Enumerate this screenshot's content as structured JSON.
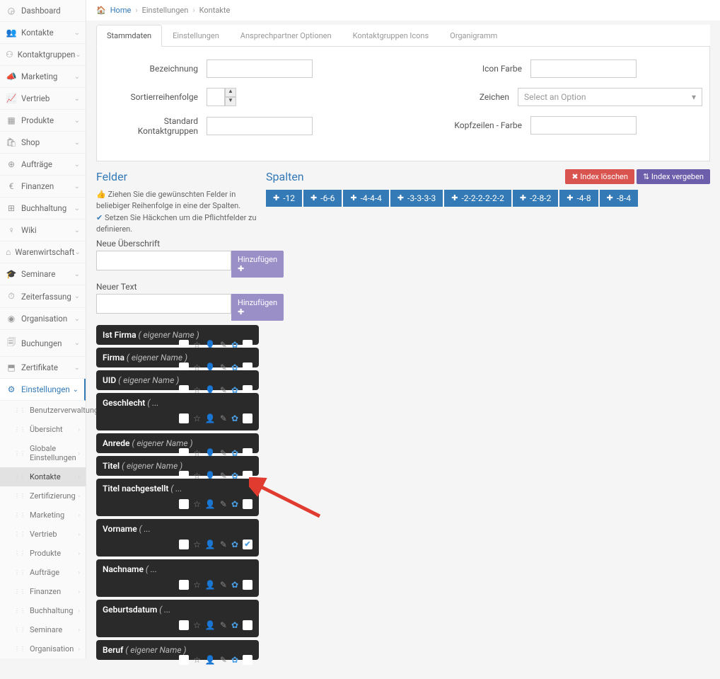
{
  "breadcrumb": {
    "home": "Home",
    "einstellungen": "Einstellungen",
    "kontakte": "Kontakte"
  },
  "nav": {
    "items": [
      {
        "label": "Dashboard",
        "icon": "◶",
        "expandable": false
      },
      {
        "label": "Kontakte",
        "icon": "👥",
        "expandable": true
      },
      {
        "label": "Kontaktgruppen",
        "icon": "⚇",
        "expandable": true
      },
      {
        "label": "Marketing",
        "icon": "📣",
        "expandable": true
      },
      {
        "label": "Vertrieb",
        "icon": "📈",
        "expandable": true
      },
      {
        "label": "Produkte",
        "icon": "▦",
        "expandable": true
      },
      {
        "label": "Shop",
        "icon": "🛍",
        "expandable": true
      },
      {
        "label": "Aufträge",
        "icon": "⊕",
        "expandable": true
      },
      {
        "label": "Finanzen",
        "icon": "€",
        "expandable": true
      },
      {
        "label": "Buchhaltung",
        "icon": "⊞",
        "expandable": true
      },
      {
        "label": "Wiki",
        "icon": "♀",
        "expandable": true
      },
      {
        "label": "Warenwirtschaft",
        "icon": "⌂",
        "expandable": true
      },
      {
        "label": "Seminare",
        "icon": "🎓",
        "expandable": true
      },
      {
        "label": "Zeiterfassung",
        "icon": "⏱",
        "expandable": true
      },
      {
        "label": "Organisation",
        "icon": "◉",
        "expandable": true
      },
      {
        "label": "Buchungen",
        "icon": "🗐",
        "expandable": true
      },
      {
        "label": "Zertifikate",
        "icon": "⬒",
        "expandable": true
      },
      {
        "label": "Einstellungen",
        "icon": "⚙",
        "expandable": true,
        "active": true
      }
    ],
    "sub": [
      {
        "label": "Benutzerverwaltung"
      },
      {
        "label": "Übersicht"
      },
      {
        "label": "Globale Einstellungen"
      },
      {
        "label": "Kontakte",
        "active": true
      },
      {
        "label": "Zertifizierung"
      },
      {
        "label": "Marketing"
      },
      {
        "label": "Vertrieb"
      },
      {
        "label": "Produkte"
      },
      {
        "label": "Aufträge"
      },
      {
        "label": "Finanzen"
      },
      {
        "label": "Buchhaltung"
      },
      {
        "label": "Seminare"
      },
      {
        "label": "Organisation"
      }
    ]
  },
  "tabs": [
    "Stammdaten",
    "Einstellungen",
    "Ansprechpartner Optionen",
    "Kontaktgruppen Icons",
    "Organigramm"
  ],
  "form": {
    "bezeichnung": "Bezeichnung",
    "sortier": "Sortierreihenfolge",
    "standard": "Standard Kontaktgruppen",
    "iconfarbe": "Icon Farbe",
    "zeichen": "Zeichen",
    "zeichen_placeholder": "Select an Option",
    "kopf": "Kopfzeilen - Farbe"
  },
  "sections": {
    "felder": "Felder",
    "spalten": "Spalten"
  },
  "hints": {
    "drag": "Ziehen Sie die gewünschten Felder in beliebiger Reihenfolge in eine der Spalten.",
    "check": "Setzen Sie Häckchen um die Pflichtfelder zu definieren."
  },
  "labels": {
    "neue_uberschrift": "Neue Überschrift",
    "neuer_text": "Neuer Text",
    "hinzufugen": "Hinzufügen",
    "index_loschen": "Index löschen",
    "index_vergeben": "Index vergeben"
  },
  "chips": [
    "-12",
    "-6-6",
    "-4-4-4",
    "-3-3-3-3",
    "-2-2-2-2-2-2",
    "-2-8-2",
    "-4-8",
    "-8-4"
  ],
  "fields": [
    {
      "title": "Ist Firma",
      "sub": "( eigener Name )",
      "compact": true
    },
    {
      "title": "Firma",
      "sub": "( eigener Name )",
      "compact": true
    },
    {
      "title": "UID",
      "sub": "( eigener Name )",
      "compact": true
    },
    {
      "title": "Geschlecht",
      "sub": "( ...",
      "compact": false
    },
    {
      "title": "Anrede",
      "sub": "( eigener Name )",
      "compact": true
    },
    {
      "title": "Titel",
      "sub": "( eigener Name )",
      "compact": true
    },
    {
      "title": "Titel nachgestellt",
      "sub": "( ...",
      "compact": false
    },
    {
      "title": "Vorname",
      "sub": "( ...",
      "compact": false,
      "checked": true
    },
    {
      "title": "Nachname",
      "sub": "( ...",
      "compact": false
    },
    {
      "title": "Geburtsdatum",
      "sub": "( ...",
      "compact": false
    },
    {
      "title": "Beruf",
      "sub": "( eigener Name )",
      "compact": true
    }
  ]
}
